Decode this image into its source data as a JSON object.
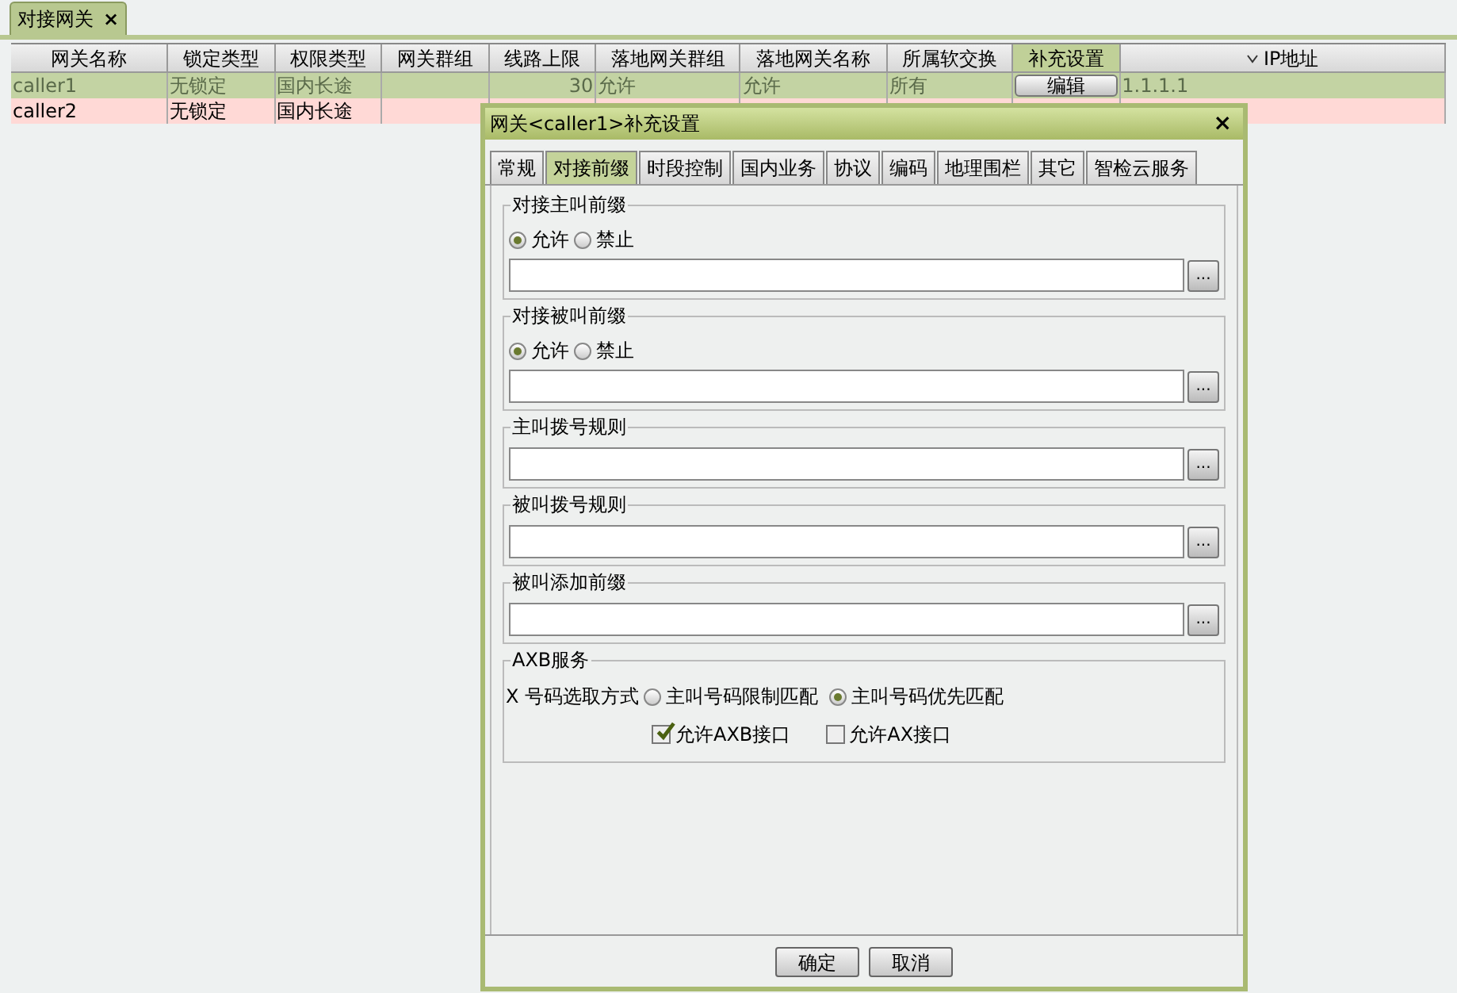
{
  "tabs": [
    {
      "label": "对接网关",
      "selected": true,
      "close": "×"
    }
  ],
  "table": {
    "columns": [
      {
        "label": "网关名称",
        "highlighted": false,
        "sorted": false
      },
      {
        "label": "锁定类型",
        "highlighted": false,
        "sorted": false
      },
      {
        "label": "权限类型",
        "highlighted": false,
        "sorted": false
      },
      {
        "label": "网关群组",
        "highlighted": false,
        "sorted": false
      },
      {
        "label": "线路上限",
        "highlighted": false,
        "sorted": false
      },
      {
        "label": "落地网关群组",
        "highlighted": false,
        "sorted": false
      },
      {
        "label": "落地网关名称",
        "highlighted": false,
        "sorted": false
      },
      {
        "label": "所属软交换",
        "highlighted": false,
        "sorted": false
      },
      {
        "label": "补充设置",
        "highlighted": true,
        "sorted": false
      },
      {
        "label": "IP地址",
        "highlighted": false,
        "sorted": true
      }
    ],
    "rows": [
      {
        "selected": true,
        "cells": [
          {
            "kind": "text",
            "text": "caller1"
          },
          {
            "kind": "text",
            "text": "无锁定"
          },
          {
            "kind": "text",
            "text": "国内长途"
          },
          {
            "kind": "blank"
          },
          {
            "kind": "number",
            "text": "30"
          },
          {
            "kind": "text",
            "text": "允许"
          },
          {
            "kind": "text",
            "text": "允许"
          },
          {
            "kind": "text",
            "text": "所有"
          },
          {
            "kind": "button",
            "text": "编辑"
          },
          {
            "kind": "text",
            "text": "1.1.1.1"
          }
        ]
      },
      {
        "selected": false,
        "cells": [
          {
            "kind": "text",
            "text": "caller2"
          },
          {
            "kind": "text",
            "text": "无锁定"
          },
          {
            "kind": "text",
            "text": "国内长途"
          }
        ]
      }
    ]
  },
  "dialog": {
    "title": "网关<caller1>补充设置",
    "close": "×",
    "tabs": [
      {
        "label": "常规",
        "selected": false
      },
      {
        "label": "对接前缀",
        "selected": true
      },
      {
        "label": "时段控制",
        "selected": false
      },
      {
        "label": "国内业务",
        "selected": false
      },
      {
        "label": "协议",
        "selected": false
      },
      {
        "label": "编码",
        "selected": false
      },
      {
        "label": "地理围栏",
        "selected": false
      },
      {
        "label": "其它",
        "selected": false
      },
      {
        "label": "智检云服务",
        "selected": false
      }
    ],
    "sections": [
      {
        "legend": "对接主叫前缀",
        "options": [
          {
            "label": "允许",
            "selected": true
          },
          {
            "label": "禁止",
            "selected": false
          }
        ],
        "browse": "..."
      },
      {
        "legend": "对接被叫前缀",
        "options": [
          {
            "label": "允许",
            "selected": true
          },
          {
            "label": "禁止",
            "selected": false
          }
        ],
        "browse": "..."
      },
      {
        "legend": "主叫拨号规则",
        "browse": "..."
      },
      {
        "legend": "被叫拨号规则",
        "browse": "..."
      },
      {
        "legend": "被叫添加前缀",
        "browse": "..."
      }
    ],
    "axb": {
      "legend": "AXB服务",
      "label": "X 号码选取方式",
      "options": [
        {
          "label": "主叫号码限制匹配",
          "selected": false
        },
        {
          "label": "主叫号码优先匹配",
          "selected": true
        }
      ],
      "checks": [
        {
          "label": "允许AXB接口",
          "checked": true
        },
        {
          "label": "允许AX接口",
          "checked": false
        }
      ]
    },
    "buttons": [
      "确定",
      "取消"
    ]
  }
}
